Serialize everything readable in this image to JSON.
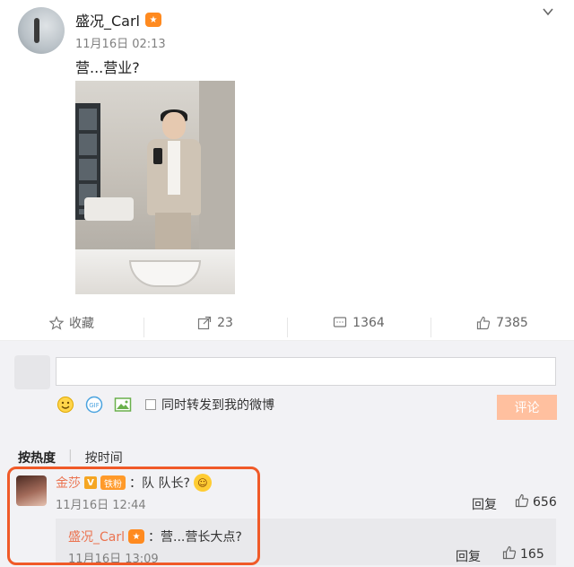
{
  "post": {
    "username": "盛况_Carl",
    "vip_badge": "vip",
    "timestamp": "11月16日 02:13",
    "text": "营...营业?"
  },
  "actions": {
    "favorite_label": "收藏",
    "repost_count": "23",
    "comment_count": "1364",
    "like_count": "7385"
  },
  "composer": {
    "repost_option": "同时转发到我的微博",
    "submit_label": "评论"
  },
  "sort": {
    "by_hot": "按热度",
    "by_time": "按时间"
  },
  "comment": {
    "name": "金莎",
    "verified": "V",
    "badge": "铁粉",
    "text": "：队 队长?",
    "timestamp": "11月16日 12:44",
    "reply_label": "回复",
    "likes": "656"
  },
  "reply": {
    "name": "盛况_Carl",
    "text": "：营...营长大点?",
    "timestamp": "11月16日 13:09",
    "reply_label": "回复",
    "likes": "165"
  },
  "colors": {
    "accent_orange": "#eb7350",
    "highlight_border": "#f05a28",
    "submit_bg": "#ffc09f"
  }
}
